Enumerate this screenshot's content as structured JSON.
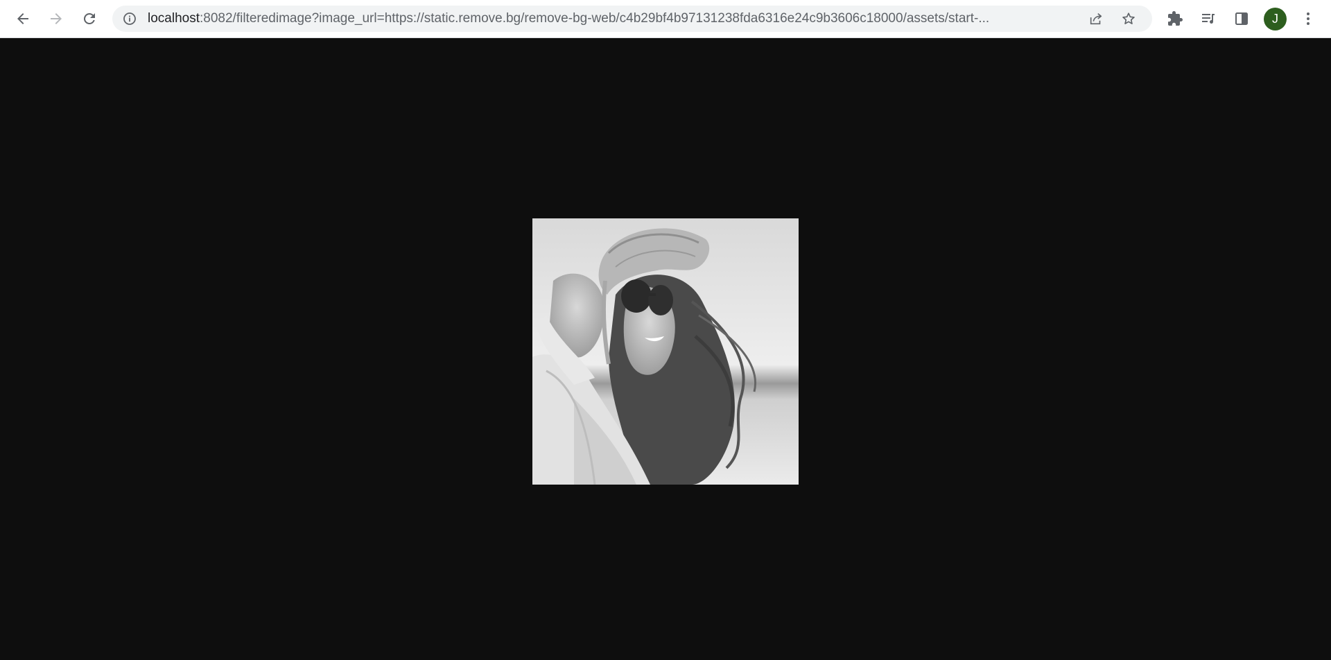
{
  "browser": {
    "url_host": "localhost",
    "url_rest": ":8082/filteredimage?image_url=https://static.remove.bg/remove-bg-web/c4b29bf4b97131238fda6316e24c9b3606c18000/assets/start-...",
    "profile_initial": "J",
    "profile_color": "#2d5e1e",
    "icons": {
      "back": "arrow-left-icon",
      "forward": "arrow-right-icon",
      "reload": "reload-icon",
      "site_info": "info-icon",
      "share": "share-icon",
      "bookmark": "star-icon",
      "extensions": "puzzle-icon",
      "media": "media-queue-icon",
      "side_panel": "side-panel-icon",
      "menu": "kebab-menu-icon"
    }
  },
  "page": {
    "background": "#0e0e0e",
    "image_description_hidden": false,
    "image_filter": "grayscale"
  }
}
